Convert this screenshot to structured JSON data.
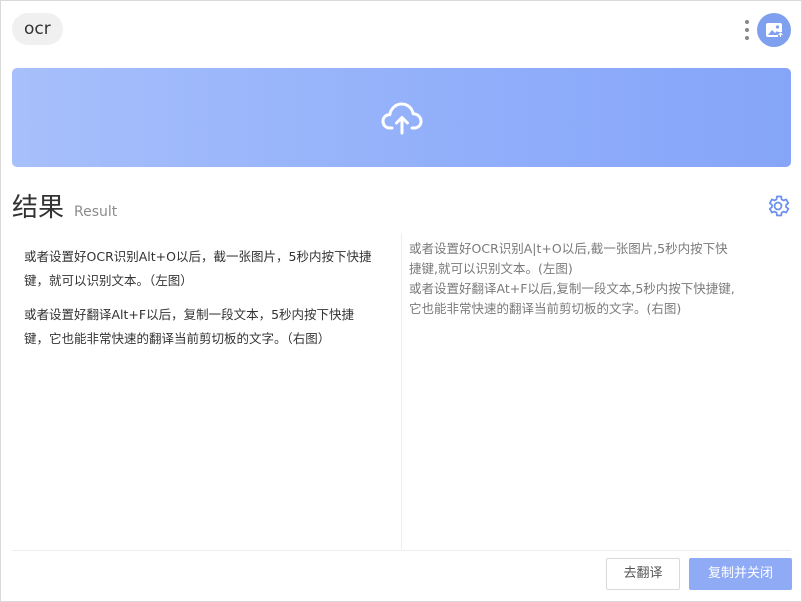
{
  "header": {
    "app_tag": "ocr",
    "icons": {
      "more": "vertical-dots-icon",
      "avatar": "image-icon"
    },
    "avatar_color": "#7fa0ee"
  },
  "upload": {
    "icon": "cloud-upload-icon",
    "gradient_start": "#a7c0fb",
    "gradient_end": "#86a5f8"
  },
  "result": {
    "title": "结果",
    "subtitle": "Result",
    "settings_icon": "gear-icon",
    "settings_color": "#6a8ff0"
  },
  "left_pane": {
    "paragraphs": [
      "或者设置好OCR识别Alt+O以后，截一张图片，5秒内按下快捷键，就可以识别文本。（左图）",
      "或者设置好翻译Alt+F以后，复制一段文本，5秒内按下快捷键，它也能非常快速的翻译当前剪切板的文字。（右图）"
    ]
  },
  "right_pane": {
    "text": "或者设置好OCR识别A|t+O以后,截一张图片,5秒内按下快捷键,就可以识别文本。(左图)\n或者设置好翻译At+F以后,复制一段文本,5秒内按下快捷键,它也能非常快速的翻译当前剪切板的文字。(右图)"
  },
  "footer": {
    "translate_label": "去翻译",
    "copy_close_label": "复制并关闭",
    "primary_color": "#8fabf6"
  }
}
